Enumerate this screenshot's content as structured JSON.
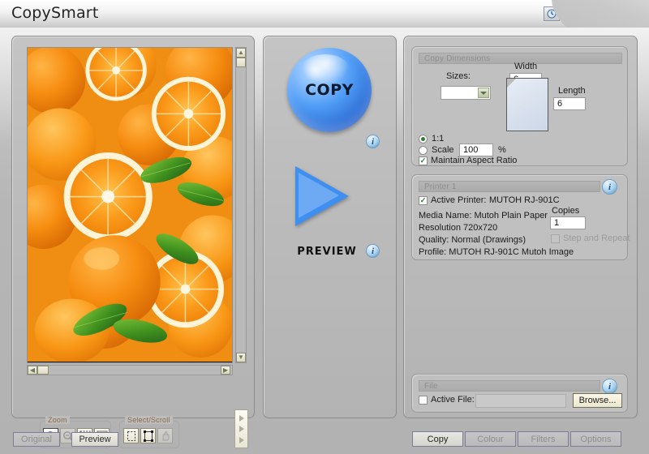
{
  "window": {
    "title": "CopySmart",
    "buttons": [
      {
        "name": "clock-icon",
        "label": ""
      },
      {
        "name": "globe-icon",
        "label": ""
      },
      {
        "name": "help-icon",
        "label": "?"
      },
      {
        "name": "minimize-icon",
        "label": ""
      },
      {
        "name": "close-icon",
        "label": "×"
      }
    ]
  },
  "image_panel": {
    "zoom_group_label": "Zoom",
    "select_group_label": "Select/Scroll",
    "zoom_tools": [
      {
        "name": "zoom-in-icon",
        "state": "active"
      },
      {
        "name": "zoom-out-icon",
        "state": "disabled"
      },
      {
        "name": "zoom-to-selection-icon",
        "state": "normal"
      },
      {
        "name": "zoom-fit-icon",
        "state": "normal"
      }
    ],
    "select_tools": [
      {
        "name": "marquee-select-icon",
        "state": "normal"
      },
      {
        "name": "select-all-icon",
        "state": "normal"
      },
      {
        "name": "pan-hand-icon",
        "state": "disabled"
      }
    ],
    "tabs": [
      {
        "label": "Original",
        "active": false
      },
      {
        "label": "Preview",
        "active": true
      }
    ]
  },
  "center": {
    "copy_label": "COPY",
    "preview_label": "PREVIEW",
    "info_copy_label": "i",
    "info_preview_label": "i"
  },
  "copy_dimensions": {
    "header": "Copy Dimensions",
    "sizes_label": "Sizes:",
    "sizes_value": "",
    "width_label": "Width",
    "width_value": "6",
    "length_label": "Length",
    "length_value": "6",
    "one_to_one_label": "1:1",
    "one_to_one_selected": true,
    "scale_label": "Scale",
    "scale_value": "100",
    "percent_label": "%",
    "maintain_aspect_label": "Maintain Aspect Ratio",
    "maintain_aspect_checked": true
  },
  "printer": {
    "header": "Printer 1",
    "info_label": "i",
    "active_printer_label": "Active Printer:",
    "active_printer_checked": true,
    "active_printer_value": "MUTOH RJ-901C",
    "media_name": "Media Name: Mutoh Plain Paper",
    "resolution": "Resolution 720x720",
    "quality": "Quality: Normal (Drawings)",
    "profile": "Profile: MUTOH RJ-901C Mutoh Image",
    "copies_label": "Copies",
    "copies_value": "1",
    "step_repeat_label": "Step and Repeat",
    "step_repeat_checked": false
  },
  "file": {
    "header": "File",
    "info_label": "i",
    "active_file_label": "Active File:",
    "active_file_checked": false,
    "active_file_value": "",
    "browse_label": "Browse..."
  },
  "mode_buttons": [
    {
      "label": "Copy",
      "active": true
    },
    {
      "label": "Colour",
      "active": false
    },
    {
      "label": "Filters",
      "active": false
    },
    {
      "label": "Options",
      "active": false
    }
  ],
  "colors": {
    "accent_blue": "#3f8ff0",
    "window_chrome": "#bdbdbd",
    "panel_bg": "#c0c0c0",
    "check_green": "#2f7d32",
    "photo_orange": "#f08a12"
  }
}
